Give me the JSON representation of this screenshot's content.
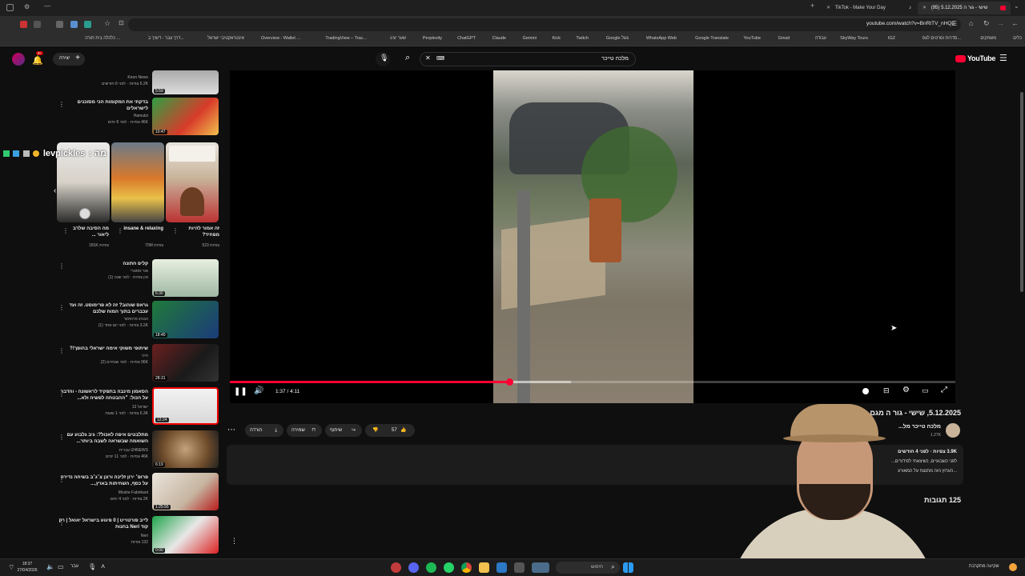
{
  "browser": {
    "tabs": [
      {
        "label": "TikTok - Make Your Day"
      },
      {
        "label": "שישי - גור ה 5.12.2025 (95)"
      }
    ],
    "url": "youtube.com/watch?v=BnRtTV_nHQo",
    "bookmarks": [
      "כלים",
      "משחקים",
      "סדרות וסרטים לצפ...",
      "IGZ",
      "SkyWay Tours",
      "עבודה",
      "Gmail",
      "YouTube",
      "Google Translate",
      "WhatsApp Web",
      "Google גוגל",
      "Twitch",
      "Kick",
      "Gemini",
      "Claude",
      "ChatGPT",
      "Perplexity",
      "שער יציג",
      "TradingView – Trac...",
      "Overview - Wallet ...",
      "אינטראקטיבי ישראל",
      "דרך צבר - דשיך ב...",
      "כלכלה בית תורה ..."
    ]
  },
  "youtube": {
    "logo_text": "YouTube",
    "search_query": "מלכה טייכר",
    "create_label": "יצירה",
    "notifications_count": "9+"
  },
  "overlay": {
    "streamer_name": "levpickles",
    "suffix": ": מה"
  },
  "recommendations": [
    {
      "title": "",
      "channel": "Keon News",
      "meta": "6.2K צפיות · לפני 6 חודשים",
      "duration": "5:59"
    },
    {
      "title": "בדקתי את המקומות הכי מסוכנים לישראלים",
      "channel": "Hamutzi",
      "meta": "46K צפיות · לפני 8 ימים",
      "duration": "10:47"
    },
    {
      "title": "קליפ חתונה",
      "channel": "אור ססטרי",
      "meta": "אין צפיות · לפני שנה (1)",
      "duration": "6:30"
    },
    {
      "title": "גראס שוהוב? זה לא פרימוסט. זה ועד עכברים בתוך המוח שלכם",
      "channel": "הבורג פרופסור",
      "meta": "3.2K צפיות · לפני יום אחד (1)",
      "duration": "18:40"
    },
    {
      "title": "שיתופי משוקי אימה ישראלי בהופך!?",
      "channel": "חיכי",
      "meta": "96K צפיות · לפני שנתיים (2)",
      "duration": "28:31"
    },
    {
      "title": "הסאמון מינבה בתפקיד לראשונה - והדבר על הכול: ״ההבטחה לפשיה ולא...",
      "channel": "ישראל 13",
      "meta": "6.3K צפיות · לפני 1 שעות",
      "duration": "12:24"
    },
    {
      "title": "מתלבטים איפה לאכול?: גיב גלבוע עם השואמה שבשראה לשבה ביותר...",
      "channel": "i24NEWS עברית",
      "meta": "46K צפיות · לפני 11 ימים",
      "duration": "6:19"
    },
    {
      "title": "פרופ׳ ירון זליכה ורונן צ׳ג׳ב בשיחה נדירה על כסף, השחיתות בארץ,...",
      "channel": "Moshe Fabrikant",
      "meta": "2K צפיות · לפני 4 ימים",
      "duration": "1:25:55"
    },
    {
      "title": "לייב פורטוייט | 0 פיגוע בישראל יאואל | רק קוד Neri בחנות",
      "channel": "Neri",
      "meta": "132 צפיות",
      "duration": "0:00"
    }
  ],
  "shorts": [
    {
      "title": "זה אמור להיות מפחיד?",
      "views": "523 צפיות"
    },
    {
      "title": "insane & relaxing",
      "views": "70M צפיות"
    },
    {
      "title": "מה הסיבה שלרב ליאור ...",
      "views": "181K צפיות"
    }
  ],
  "player": {
    "time_display": "1:37 / 4:11",
    "progress": 0.386,
    "buffer": 0.47
  },
  "video_info": {
    "title": "5.12.2025, שישי - גור ה מגם הרס עציצים...",
    "channel": "מלכה טייכר מל...",
    "subscribers": "1.27K",
    "likes": "57",
    "share_label": "שיתוף",
    "save_label": "שמירה",
    "download_label": "הורדה",
    "views_date": "3.9K צפיות · לפני 4 חודשים",
    "desc_line1": "לפני כשבועיים, כשיצאתי לסידורים...",
    "desc_line2": "...הערוץ הזה מתנצח על המאורע",
    "comments_count": "125 תגובות"
  },
  "taskbar": {
    "time": "18:37",
    "date": "27/04/2026",
    "lang": "עבר",
    "search": "חיפוש",
    "weather": "שקיעה מתקרבת"
  },
  "colors": {
    "youtube_red": "#ff0033",
    "bg": "#0f0f0f"
  }
}
